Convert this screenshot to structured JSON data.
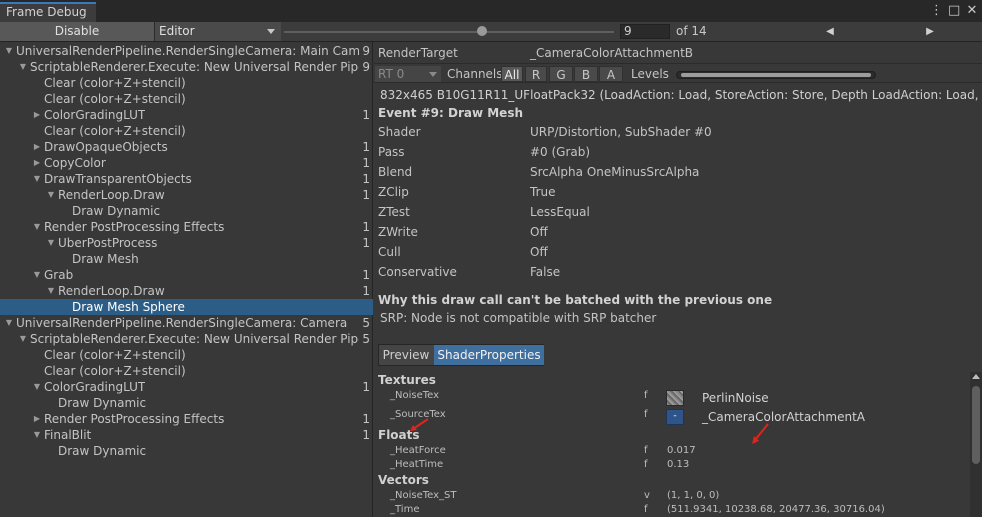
{
  "window": {
    "tab_title": "Frame Debug",
    "icons": [
      "more-icon",
      "maximize-icon",
      "close-icon"
    ]
  },
  "toolbar": {
    "disable_label": "Disable",
    "mode_value": "Editor",
    "frame_value": "9",
    "frame_total_label": "of 14",
    "frame_progress": 0.6,
    "prev_glyph": "◀",
    "next_glyph": "▶"
  },
  "tree": {
    "rows": [
      {
        "label": "UniversalRenderPipeline.RenderSingleCamera: Main Camera",
        "count": "9",
        "arrow": "▼"
      },
      {
        "label": "ScriptableRenderer.Execute: New Universal Render Pipeline",
        "count": "9",
        "arrow": "▼"
      },
      {
        "label": "Clear (color+Z+stencil)",
        "count": "",
        "arrow": ""
      },
      {
        "label": "Clear (color+Z+stencil)",
        "count": "",
        "arrow": ""
      },
      {
        "label": "ColorGradingLUT",
        "count": "1",
        "arrow": "▶"
      },
      {
        "label": "Clear (color+Z+stencil)",
        "count": "",
        "arrow": ""
      },
      {
        "label": "DrawOpaqueObjects",
        "count": "1",
        "arrow": "▶"
      },
      {
        "label": "CopyColor",
        "count": "1",
        "arrow": "▶"
      },
      {
        "label": "DrawTransparentObjects",
        "count": "1",
        "arrow": "▼"
      },
      {
        "label": "RenderLoop.Draw",
        "count": "1",
        "arrow": "▼"
      },
      {
        "label": "Draw Dynamic",
        "count": "",
        "arrow": ""
      },
      {
        "label": "Render PostProcessing Effects",
        "count": "1",
        "arrow": "▼"
      },
      {
        "label": "UberPostProcess",
        "count": "1",
        "arrow": "▼"
      },
      {
        "label": "Draw Mesh",
        "count": "",
        "arrow": ""
      },
      {
        "label": "Grab",
        "count": "1",
        "arrow": "▼"
      },
      {
        "label": "RenderLoop.Draw",
        "count": "1",
        "arrow": "▼"
      },
      {
        "label": "Draw Mesh Sphere",
        "count": "",
        "arrow": "",
        "selected": true
      },
      {
        "label": "UniversalRenderPipeline.RenderSingleCamera: Camera",
        "count": "5",
        "arrow": "▼"
      },
      {
        "label": "ScriptableRenderer.Execute: New Universal Render Pipeline",
        "count": "5",
        "arrow": "▼"
      },
      {
        "label": "Clear (color+Z+stencil)",
        "count": "",
        "arrow": ""
      },
      {
        "label": "Clear (color+Z+stencil)",
        "count": "",
        "arrow": ""
      },
      {
        "label": "ColorGradingLUT",
        "count": "1",
        "arrow": "▼"
      },
      {
        "label": "Draw Dynamic",
        "count": "",
        "arrow": ""
      },
      {
        "label": "Render PostProcessing Effects",
        "count": "1",
        "arrow": "▶"
      },
      {
        "label": "FinalBlit",
        "count": "1",
        "arrow": "▼"
      },
      {
        "label": "Draw Dynamic",
        "count": "",
        "arrow": ""
      }
    ]
  },
  "details": {
    "render_target_label": "RenderTarget",
    "render_target_value": "_CameraColorAttachmentB",
    "rt_select_value": "RT 0",
    "channels_label": "Channels",
    "channels": [
      "All",
      "R",
      "G",
      "B",
      "A"
    ],
    "levels_label": "Levels",
    "format_line": "832x465 B10G11R11_UFloatPack32 (LoadAction: Load, StoreAction: Store, Depth LoadAction: Load, Depth",
    "event_title": "Event #9: Draw Mesh",
    "properties": [
      {
        "key": "Shader",
        "value": "URP/Distortion, SubShader #0"
      },
      {
        "key": "Pass",
        "value": "#0 (Grab)"
      },
      {
        "key": "Blend",
        "value": "SrcAlpha OneMinusSrcAlpha"
      },
      {
        "key": "ZClip",
        "value": "True"
      },
      {
        "key": "ZTest",
        "value": "LessEqual"
      },
      {
        "key": "ZWrite",
        "value": "Off"
      },
      {
        "key": "Cull",
        "value": "Off"
      },
      {
        "key": "Conservative",
        "value": "False"
      }
    ],
    "batch_heading": "Why this draw call can't be batched with the previous one",
    "batch_reason": "SRP: Node is not compatible with SRP batcher",
    "tabs": [
      "Preview",
      "ShaderProperties"
    ]
  },
  "shader_properties": {
    "textures_heading": "Textures",
    "textures": [
      {
        "name": "_NoiseTex",
        "type": "f",
        "texture": "PerlinNoise"
      },
      {
        "name": "_SourceTex",
        "type": "f",
        "thumb_glyph": "-",
        "texture": "_CameraColorAttachmentA"
      }
    ],
    "floats_heading": "Floats",
    "floats": [
      {
        "name": "_HeatForce",
        "type": "f",
        "value": "0.017"
      },
      {
        "name": "_HeatTime",
        "type": "f",
        "value": "0.13"
      }
    ],
    "vectors_heading": "Vectors",
    "vectors": [
      {
        "name": "_NoiseTex_ST",
        "type": "v",
        "value": "(1, 1, 0, 0)"
      },
      {
        "name": "_Time",
        "type": "f",
        "value": "(511.9341, 10238.68, 20477.36, 30716.04)"
      }
    ]
  },
  "colors": {
    "selection": "#2c5d87",
    "active_tab": "#3f6f9e",
    "annotation_arrow": "#e0241b"
  }
}
